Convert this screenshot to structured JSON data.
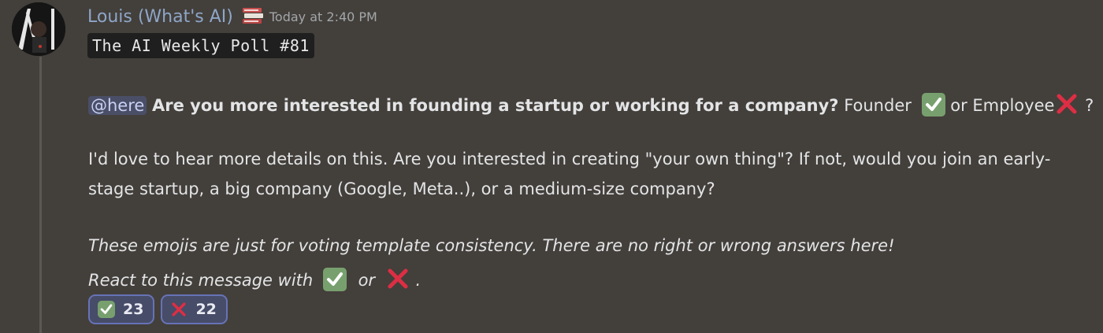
{
  "message": {
    "author": "Louis (What's AI)",
    "author_icon": "books-icon",
    "timestamp": "Today at 2:40 PM",
    "title_code": "The AI Weekly Poll #81",
    "mention": "@here",
    "question_bold": "Are you more interested in founding a startup or working for a company?",
    "question_founder": "Founder",
    "question_or": "or Employee",
    "question_end": "?",
    "details_line1": "I'd love to hear more details on this. Are you interested in creating \"your own thing\"? If not, would you join an early-",
    "details_line2": "stage startup, a big company (Google, Meta..), or a medium-size company?",
    "note_line1": "These emojis are just for voting template consistency. There are no right or wrong answers here!",
    "note_line2_prefix": "React to this message with",
    "note_line2_or": "or",
    "note_line2_end": "."
  },
  "reactions": [
    {
      "emoji": "check-mark-icon",
      "count": "23"
    },
    {
      "emoji": "cross-mark-icon",
      "count": "22"
    }
  ],
  "colors": {
    "background": "#433f3b",
    "author": "#8ea6c8",
    "mention_bg": "#4a4f67",
    "reaction_border": "#6773b6",
    "check_green": "#78a06e",
    "cross_red": "#dd2e44"
  }
}
